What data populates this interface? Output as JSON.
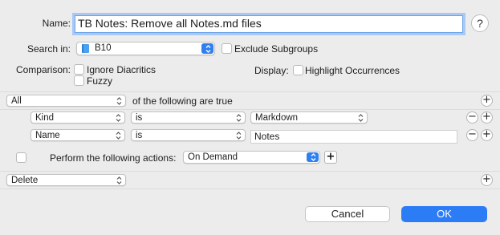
{
  "name": {
    "label": "Name:",
    "value": "TB Notes: Remove all Notes.md files",
    "help": "?"
  },
  "search_in": {
    "label": "Search in:",
    "value": "B10",
    "exclude_subgroups": "Exclude Subgroups"
  },
  "comparison": {
    "label": "Comparison:",
    "ignore_diacritics": "Ignore Diacritics",
    "fuzzy": "Fuzzy"
  },
  "display": {
    "label": "Display:",
    "highlight": "Highlight Occurrences"
  },
  "criteria": {
    "match_value": "All",
    "suffix": "of the following are true",
    "rows": [
      {
        "field": "Kind",
        "operator": "is",
        "value": "Markdown"
      },
      {
        "field": "Name",
        "operator": "is",
        "value": "Notes"
      }
    ]
  },
  "actions": {
    "label": "Perform the following actions:",
    "trigger": "On Demand",
    "action": "Delete"
  },
  "buttons": {
    "add": "+",
    "remove": "−",
    "cancel": "Cancel",
    "ok": "OK"
  },
  "colors": {
    "accent": "#2c7cf6",
    "window_bg": "#ececec"
  }
}
